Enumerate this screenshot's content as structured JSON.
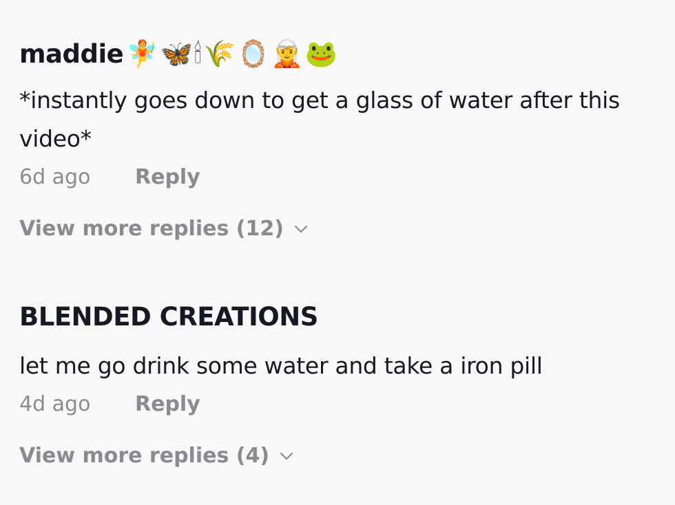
{
  "comments": [
    {
      "author": "maddie",
      "emojis": "🧚🦋🕯🌾🪞🧝🐸",
      "text": "*instantly goes down to get a glass of water after this video*",
      "date": "6d ago",
      "reply_label": "Reply",
      "more_replies_label": "View more replies (12)"
    },
    {
      "author": "BLENDED CREATIONS",
      "emojis": "",
      "text": "let me go drink some water and take a iron pill",
      "date": "4d ago",
      "reply_label": "Reply",
      "more_replies_label": "View more replies (4)"
    }
  ],
  "icons": {
    "chevron": "chevron-down-icon"
  },
  "colors": {
    "background": "#f8f8f8",
    "primary_text": "#161823",
    "secondary_text": "#8a8b91"
  }
}
